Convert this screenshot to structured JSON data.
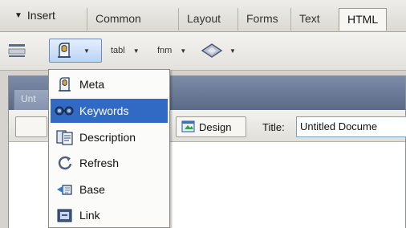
{
  "insert_bar": {
    "menu_label": "Insert",
    "tabs": [
      {
        "label": "Common"
      },
      {
        "label": "Layout"
      },
      {
        "label": "Forms"
      },
      {
        "label": "Text"
      },
      {
        "label": "HTML"
      }
    ]
  },
  "toolbar": {
    "items": [
      {
        "label": "tabl",
        "icon": "table-icon"
      },
      {
        "label": "fnm",
        "icon": "frameset-icon"
      }
    ]
  },
  "head_menu": {
    "items": [
      {
        "label": "Meta",
        "icon": "meta-icon",
        "selected": false
      },
      {
        "label": "Keywords",
        "icon": "keywords-icon",
        "selected": true
      },
      {
        "label": "Description",
        "icon": "description-icon",
        "selected": false
      },
      {
        "label": "Refresh",
        "icon": "refresh-icon",
        "selected": false
      },
      {
        "label": "Base",
        "icon": "base-icon",
        "selected": false
      },
      {
        "label": "Link",
        "icon": "link-icon",
        "selected": false
      }
    ]
  },
  "document": {
    "tab_label": "Unt",
    "design_label": "Design",
    "title_label": "Title:",
    "title_value": "Untitled Docume"
  },
  "colors": {
    "selection": "#316ac5",
    "window_title": "#6b7a98"
  }
}
